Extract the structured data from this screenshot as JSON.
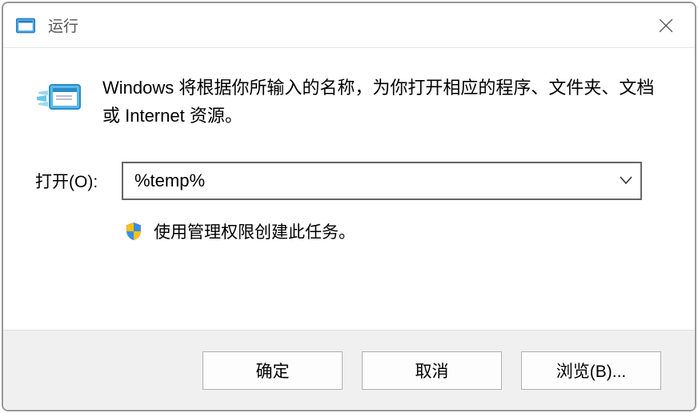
{
  "titlebar": {
    "title": "运行"
  },
  "content": {
    "description": "Windows 将根据你所输入的名称，为你打开相应的程序、文件夹、文档或 Internet 资源。",
    "open_label": "打开(O):",
    "command_value": "%temp%",
    "admin_note": "使用管理权限创建此任务。"
  },
  "buttons": {
    "ok": "确定",
    "cancel": "取消",
    "browse": "浏览(B)..."
  }
}
